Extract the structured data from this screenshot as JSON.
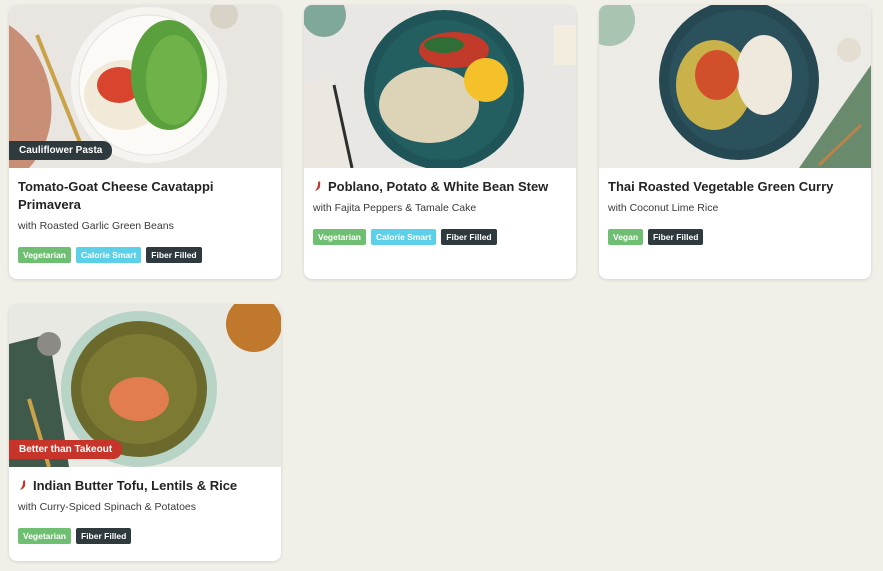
{
  "recipes": [
    {
      "ribbon": "Cauliflower Pasta",
      "title": "Tomato-Goat Cheese Cavatappi Primavera",
      "subtitle": "with Roasted Garlic Green Beans",
      "spicy": false,
      "tags": [
        "Vegetarian",
        "Calorie Smart",
        "Fiber Filled"
      ]
    },
    {
      "ribbon": "",
      "title": "Poblano, Potato & White Bean Stew",
      "subtitle": "with Fajita Peppers & Tamale Cake",
      "spicy": true,
      "tags": [
        "Vegetarian",
        "Calorie Smart",
        "Fiber Filled"
      ]
    },
    {
      "ribbon": "",
      "title": "Thai Roasted Vegetable Green Curry",
      "subtitle": "with Coconut Lime Rice",
      "spicy": false,
      "tags": [
        "Vegan",
        "Fiber Filled"
      ]
    },
    {
      "ribbon": "Better than Takeout",
      "title": "Indian Butter Tofu, Lentils & Rice",
      "subtitle": "with Curry-Spiced Spinach & Potatoes",
      "spicy": true,
      "tags": [
        "Vegetarian",
        "Fiber Filled"
      ]
    }
  ],
  "tag_colors": {
    "Vegetarian": "#6fbf73",
    "Vegan": "#6fbf73",
    "Calorie Smart": "#5bd0e8",
    "Fiber Filled": "#2f3a3f"
  },
  "ribbon_colors": {
    "Cauliflower Pasta": "#2f3a3f",
    "Better than Takeout": "#c7342a"
  },
  "icons": {
    "spicy": "chili-pepper-icon"
  }
}
